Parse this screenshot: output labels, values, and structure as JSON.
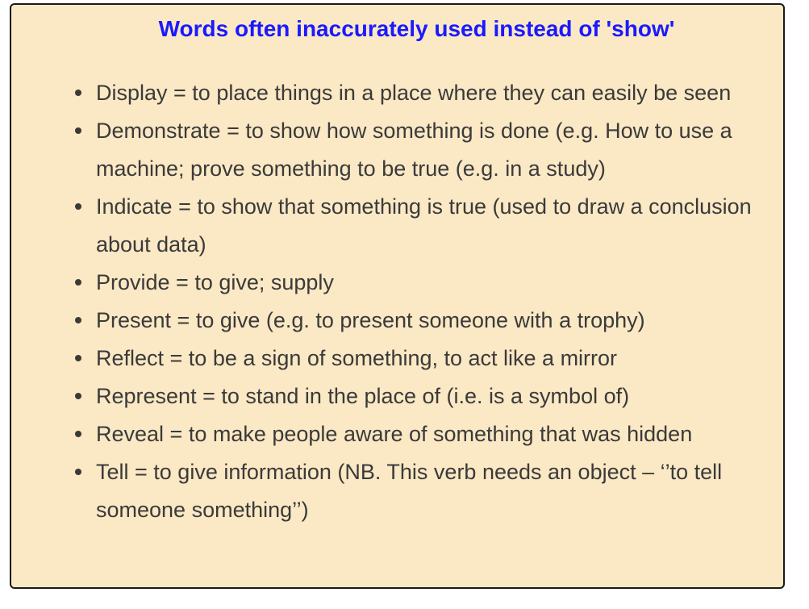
{
  "title": "Words often inaccurately used instead of 'show'",
  "items": [
    "Display = to place things in a place where they can easily be seen",
    "Demonstrate = to show how something is done (e.g. How to use a machine; prove something to be true (e.g. in a study)",
    "Indicate = to show that something is true (used to draw a conclusion about data)",
    "Provide = to give; supply",
    "Present = to give (e.g. to present someone with a trophy)",
    "Reflect = to be a sign of something, to act like a mirror",
    "Represent = to stand in the place of (i.e. is a symbol of)",
    "Reveal = to make people aware of something that was hidden",
    "Tell = to give information (NB. This verb needs an object – ‘’to tell someone something’’)"
  ]
}
